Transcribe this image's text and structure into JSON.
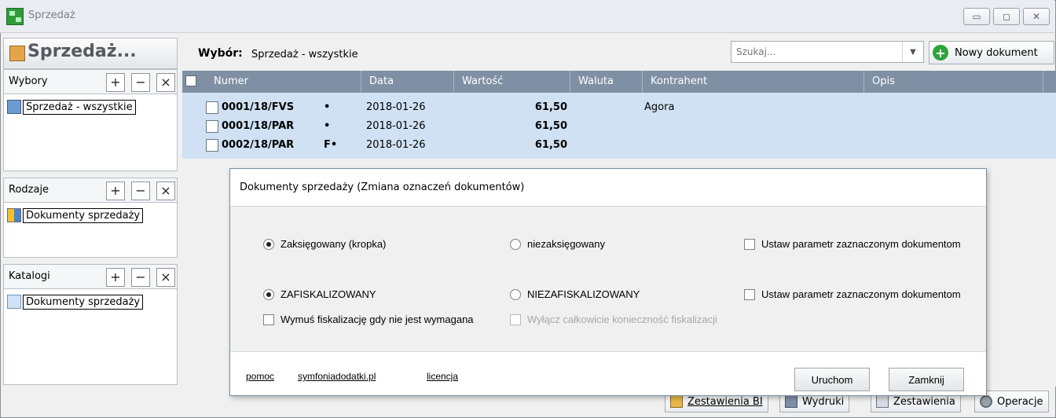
{
  "window": {
    "title": "Sprzedaż"
  },
  "left_panel": {
    "header": "Sprzedaż...",
    "sections": [
      {
        "label": "Wybory",
        "item": "Sprzedaż - wszystkie",
        "item_icon": "search-chart-icon"
      },
      {
        "label": "Rodzaje",
        "item": "Dokumenty sprzedaży",
        "item_icon": "grid-icon"
      },
      {
        "label": "Katalogi",
        "item": "Dokumenty sprzedaży",
        "item_icon": "folder-icon"
      }
    ],
    "add": "+",
    "remove": "−",
    "close": "×"
  },
  "toolbar": {
    "wybor_label": "Wybór:",
    "wybor_value": "Sprzedaż - wszystkie",
    "search_placeholder": "Szukaj...",
    "new_doc": "Nowy dokument"
  },
  "table": {
    "columns": [
      "Numer",
      "Data",
      "Wartość",
      "Waluta",
      "Kontrahent",
      "Opis"
    ],
    "rows": [
      {
        "number": "0001/18/FVS",
        "flag": "•",
        "date": "2018-01-26",
        "value": "61,50",
        "contractor": "Agora"
      },
      {
        "number": "0001/18/PAR",
        "flag": "•",
        "date": "2018-01-26",
        "value": "61,50",
        "contractor": ""
      },
      {
        "number": "0002/18/PAR",
        "flag": "F•",
        "date": "2018-01-26",
        "value": "61,50",
        "contractor": ""
      }
    ]
  },
  "bottom_toolbar": {
    "zestawienia_bi": "Zestawienia BI",
    "wydruki": "Wydruki",
    "zestawienia": "Zestawienia",
    "operacje": "Operacje"
  },
  "dialog": {
    "title": "Dokumenty sprzedaży (Zmiana oznaczeń dokumentów)",
    "row1": {
      "opt_on": "Zaksięgowany (kropka)",
      "opt_off": "niezaksięgowany",
      "apply": "Ustaw parametr zaznaczonym dokumentom"
    },
    "row2": {
      "opt_on": "ZAFISKALIZOWANY",
      "opt_off": "NIEZAFISKALIZOWANY",
      "apply": "Ustaw parametr zaznaczonym dokumentom"
    },
    "force_fiscal": "Wymuś fiskalizację gdy nie jest wymagana",
    "disable_fiscal": "Wyłącz całkowicie konieczność fiskalizacji",
    "links": {
      "help": "pomoc",
      "site": "symfoniadodatki.pl",
      "license": "licencja"
    },
    "buttons": {
      "run": "Uruchom",
      "close": "Zamknij"
    }
  }
}
